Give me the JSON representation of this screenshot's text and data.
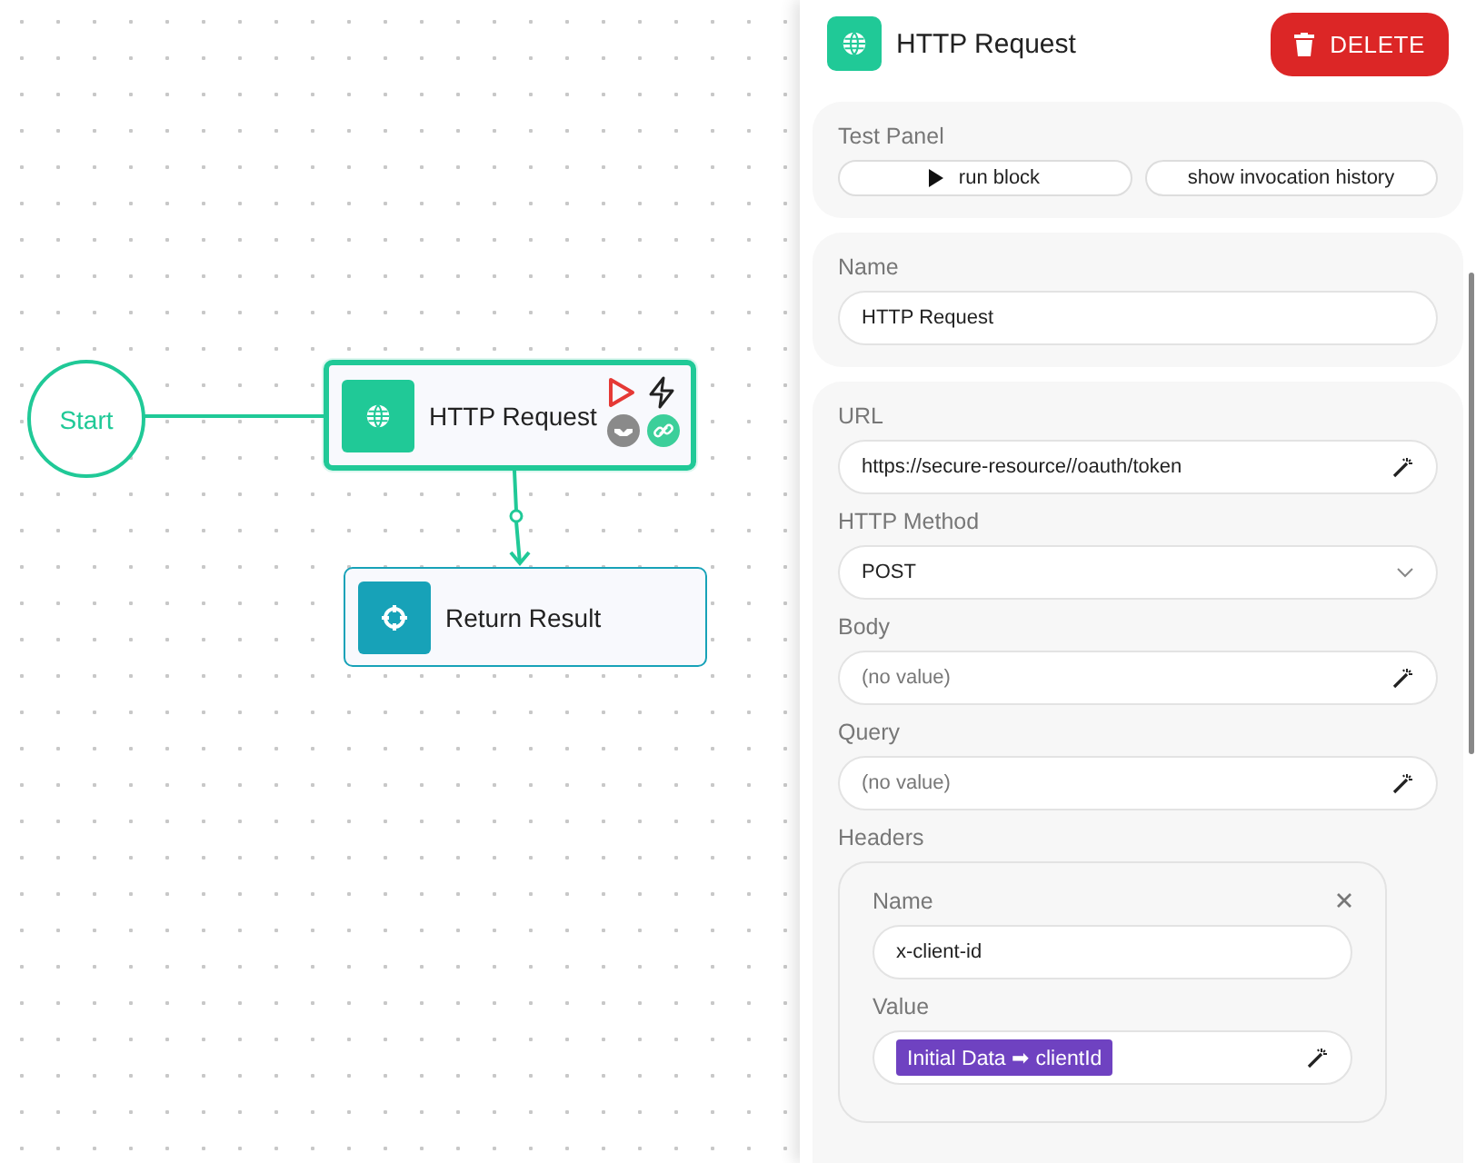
{
  "canvas": {
    "nodes": [
      {
        "kind": "start",
        "label": "Start",
        "color": "#20c997"
      },
      {
        "kind": "request",
        "label": "HTTP Request",
        "color": "#20c997",
        "selected": true
      },
      {
        "kind": "result",
        "label": "Return Result",
        "color": "#17a2b8",
        "selected": false
      }
    ]
  },
  "panel": {
    "title": "HTTP Request",
    "delete_button": "DELETE",
    "test_panel": {
      "label": "Test Panel",
      "buttons": [
        {
          "label": "run block",
          "kind": "run"
        },
        {
          "label": "show invocation history",
          "kind": "plain"
        }
      ]
    },
    "name_field": {
      "label": "Name",
      "value": "HTTP Request"
    },
    "fields": [
      {
        "kind": "text",
        "label": "URL",
        "value": "https://secure-resource//oauth/token"
      },
      {
        "kind": "select",
        "label": "HTTP Method",
        "value": "POST"
      },
      {
        "kind": "text",
        "label": "Body",
        "placeholder": "(no value)"
      },
      {
        "kind": "text",
        "label": "Query",
        "placeholder": "(no value)"
      }
    ],
    "headers": {
      "label": "Headers",
      "items": [
        {
          "name_label": "Name",
          "name": "x-client-id",
          "value_label": "Value",
          "value_token": "Initial Data ➡ clientId"
        }
      ]
    }
  }
}
